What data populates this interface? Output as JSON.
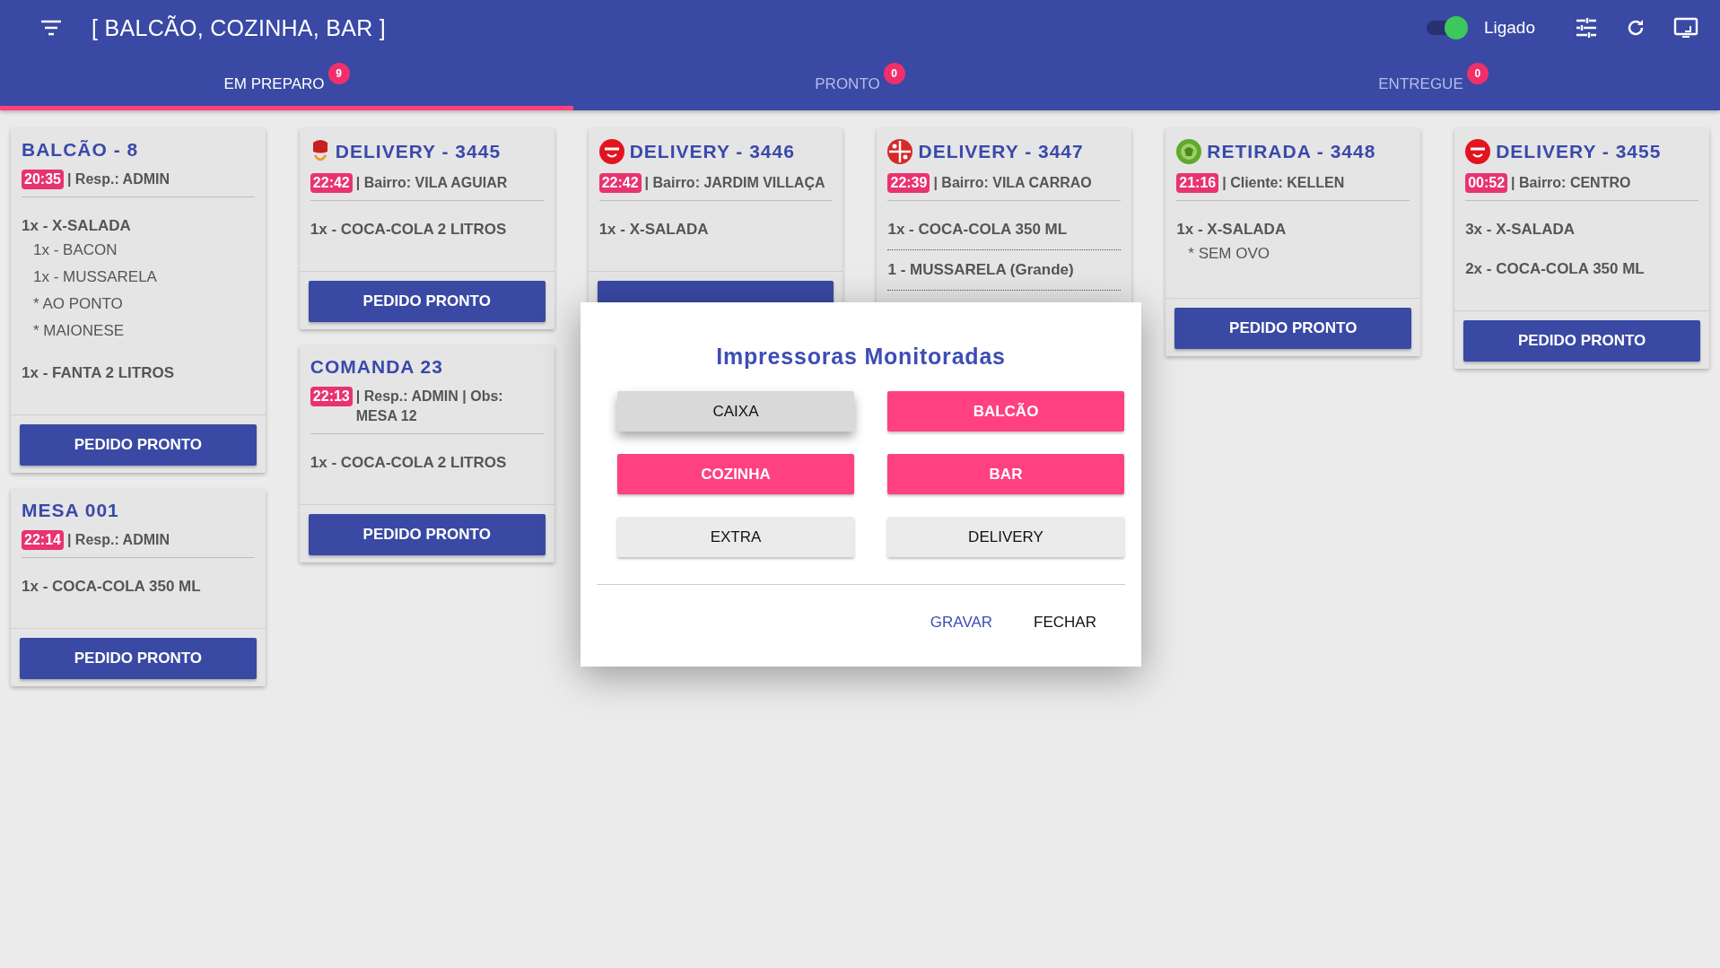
{
  "header": {
    "title": "[ BALCÃO, COZINHA, BAR ]",
    "toggle": {
      "label": "Ligado",
      "on": true
    }
  },
  "tabs": [
    {
      "label": "EM PREPARO",
      "count": "9",
      "selected": true
    },
    {
      "label": "PRONTO",
      "count": "0",
      "selected": false
    },
    {
      "label": "ENTREGUE",
      "count": "0",
      "selected": false
    }
  ],
  "columns": [
    {
      "cards": [
        {
          "title": "BALCÃO - 8",
          "time": "20:35",
          "info": "| Resp.: ADMIN",
          "separated": false,
          "items": [
            {
              "text": "1x - X-SALADA",
              "children": [
                {
                  "text": "1x - BACON"
                },
                {
                  "text": "1x - MUSSARELA"
                },
                {
                  "text": "* AO PONTO"
                },
                {
                  "text": "* MAIONESE"
                }
              ]
            },
            {
              "text": "1x - FANTA 2 LITROS"
            }
          ],
          "button": "PEDIDO PRONTO"
        },
        {
          "title": "MESA 001",
          "time": "22:14",
          "info": "| Resp.: ADMIN",
          "separated": false,
          "items": [
            {
              "text": "1x - COCA-COLA 350 ML"
            }
          ],
          "button": "PEDIDO PRONTO"
        }
      ]
    },
    {
      "cards": [
        {
          "title": "DELIVERY - 3445",
          "kind": "hat",
          "time": "22:42",
          "info": "| Bairro: VILA AGUIAR",
          "separated": false,
          "items": [
            {
              "text": "1x - COCA-COLA 2 LITROS"
            }
          ],
          "button": "PEDIDO PRONTO"
        },
        {
          "title": "COMANDA 23",
          "time": "22:13",
          "info": "| Resp.: ADMIN | Obs: MESA 12",
          "separated": false,
          "items": [
            {
              "text": "1x - COCA-COLA 2 LITROS"
            }
          ],
          "button": "PEDIDO PRONTO"
        }
      ]
    },
    {
      "cards": [
        {
          "title": "DELIVERY - 3446",
          "kind": "red-smile",
          "time": "22:42",
          "info": "| Bairro: JARDIM VILLAÇA",
          "separated": false,
          "items": [
            {
              "text": "1x - X-SALADA"
            }
          ],
          "button_covered": true
        }
      ]
    },
    {
      "cards": [
        {
          "title": "DELIVERY - 3447",
          "kind": "red-cross",
          "time": "22:39",
          "info": "| Bairro: VILA CARRAO",
          "separated": true,
          "items": [
            {
              "text": "1x - COCA-COLA 350 ML"
            },
            {
              "text": "1 - MUSSARELA (Grande)"
            }
          ]
        }
      ]
    },
    {
      "cards": [
        {
          "title": "RETIRADA - 3448",
          "kind": "green",
          "time": "21:16",
          "info": "| Cliente: KELLEN",
          "separated": false,
          "items": [
            {
              "text": "1x - X-SALADA",
              "children": [
                {
                  "text": "* SEM OVO"
                }
              ]
            }
          ],
          "button": "PEDIDO PRONTO"
        }
      ]
    },
    {
      "cards": [
        {
          "title": "DELIVERY - 3455",
          "kind": "red-smile",
          "time": "00:52",
          "info": "| Bairro: CENTRO",
          "separated": false,
          "items": [
            {
              "text": "3x - X-SALADA"
            },
            {
              "text": "2x - COCA-COLA 350 ML"
            }
          ],
          "button": "PEDIDO PRONTO"
        }
      ]
    }
  ],
  "dialog": {
    "title": "Impressoras Monitoradas",
    "printers": [
      {
        "label": "CAIXA",
        "selected": false,
        "focused": true
      },
      {
        "label": "BALCÃO",
        "selected": true,
        "focused": false
      },
      {
        "label": "COZINHA",
        "selected": true,
        "focused": false
      },
      {
        "label": "BAR",
        "selected": true,
        "focused": false
      },
      {
        "label": "EXTRA",
        "selected": false,
        "focused": false
      },
      {
        "label": "DELIVERY",
        "selected": false,
        "focused": false
      }
    ],
    "actions": [
      {
        "label": "GRAVAR",
        "kind": "primary"
      },
      {
        "label": "FECHAR",
        "kind": "plain"
      }
    ]
  }
}
